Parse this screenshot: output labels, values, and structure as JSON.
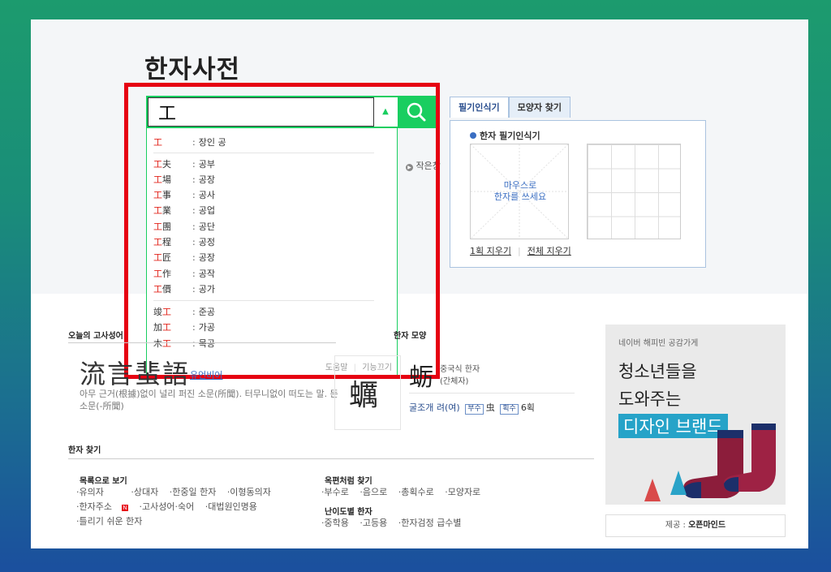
{
  "page": {
    "title": "한자사전"
  },
  "search": {
    "value": "工",
    "toggle_glyph": "▲"
  },
  "autocomplete": {
    "first": {
      "hanja": "工",
      "rest": "",
      "reading": "장인 공"
    },
    "compounds": [
      {
        "hanja": "工",
        "rest": "夫",
        "reading": "공부"
      },
      {
        "hanja": "工",
        "rest": "場",
        "reading": "공장"
      },
      {
        "hanja": "工",
        "rest": "事",
        "reading": "공사"
      },
      {
        "hanja": "工",
        "rest": "業",
        "reading": "공업"
      },
      {
        "hanja": "工",
        "rest": "團",
        "reading": "공단"
      },
      {
        "hanja": "工",
        "rest": "程",
        "reading": "공정"
      },
      {
        "hanja": "工",
        "rest": "匠",
        "reading": "공장"
      },
      {
        "hanja": "工",
        "rest": "作",
        "reading": "공작"
      },
      {
        "hanja": "工",
        "rest": "價",
        "reading": "공가"
      }
    ],
    "suffix": [
      {
        "pre": "竣",
        "hanja": "工",
        "reading": "준공"
      },
      {
        "pre": "加",
        "hanja": "工",
        "reading": "가공"
      },
      {
        "pre": "木",
        "hanja": "工",
        "reading": "목공"
      }
    ],
    "colon": ":",
    "footer": {
      "help": "도움말",
      "sep": "|",
      "off": "기능끄기"
    }
  },
  "background_fragment": {
    "text": "작은창"
  },
  "handwriting": {
    "tabs": [
      "필기인식기",
      "모양자 찾기"
    ],
    "title": "한자 필기인식기",
    "draw_hint_1": "마우스로",
    "draw_hint_2": "한자를 쓰세요",
    "clear_one": "1획 지우기",
    "clear_all": "전체 지우기"
  },
  "idiom": {
    "section_title": "오늘의 고사성어",
    "hanja": "流言蜚語",
    "reading": "유언비어",
    "desc": "아무 근거(根據)없이 널리 퍼진 소문(所聞). 터무니없이 떠도는 말. 뜬소문(-所聞)"
  },
  "word": {
    "section_title": "오늘의 한자 모양",
    "char_big": "蠣",
    "char_mid": "蛎",
    "char_info_1": "중국식 한자",
    "char_info_2": "(간체자)",
    "meaning": "굴조개 려(여)",
    "radical_label": "부수",
    "radical": "虫",
    "strokes_label": "획수",
    "strokes": "6획"
  },
  "find": {
    "section_title": "한자 찾기",
    "list": {
      "head": "목록으로 보기",
      "items": [
        "·유의자",
        "·상대자",
        "·한중일 한자",
        "·이형동의자",
        "·한자주소",
        "·고사성어·숙어",
        "·대법원인명용",
        "·틀리기 쉬운 한자"
      ]
    },
    "dict": {
      "head": "옥편처럼 찾기",
      "items": [
        "·부수로",
        "·음으로",
        "·총획수로",
        "·모양자로"
      ]
    },
    "level": {
      "head": "난이도별 한자",
      "items": [
        "·중학용",
        "·고등용",
        "·한자검정 급수별"
      ]
    }
  },
  "ad": {
    "top": "네이버 해피빈 공감가게",
    "line1": "청소년들을",
    "line2": "도와주는",
    "brand": "디자인 브랜드",
    "caption_label": "제공 :",
    "caption_value": "오픈마인드"
  },
  "colors": {
    "accent": "#19ce60",
    "highlight": "#e60012",
    "link": "#2b4f8f"
  }
}
